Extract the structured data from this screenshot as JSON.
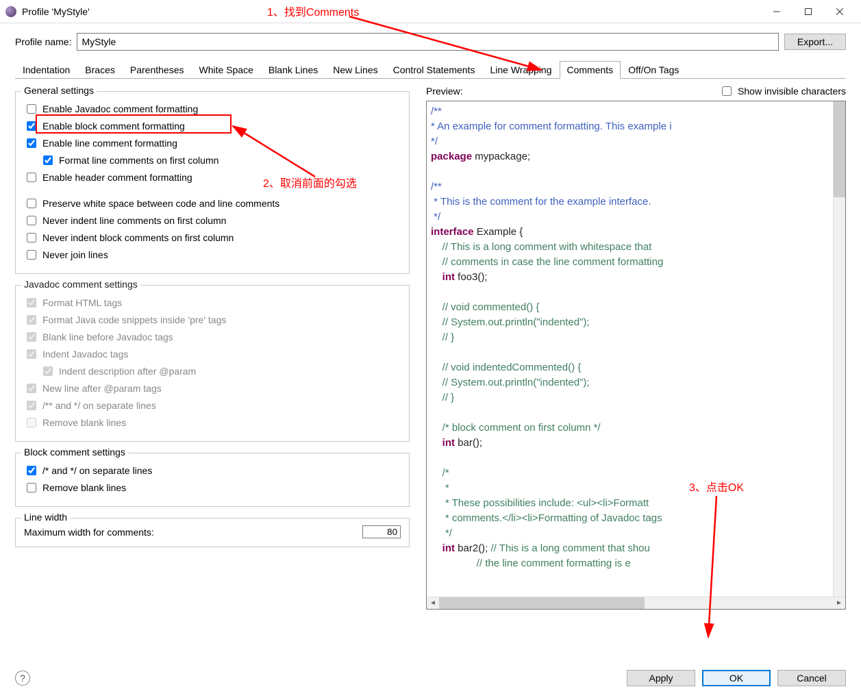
{
  "window": {
    "title": "Profile 'MyStyle'"
  },
  "profile": {
    "label": "Profile name:",
    "value": "MyStyle",
    "export_label": "Export..."
  },
  "tabs": {
    "items": [
      {
        "label": "Indentation"
      },
      {
        "label": "Braces"
      },
      {
        "label": "Parentheses"
      },
      {
        "label": "White Space"
      },
      {
        "label": "Blank Lines"
      },
      {
        "label": "New Lines"
      },
      {
        "label": "Control Statements"
      },
      {
        "label": "Line Wrapping"
      },
      {
        "label": "Comments"
      },
      {
        "label": "Off/On Tags"
      }
    ],
    "active_index": 8
  },
  "general": {
    "legend": "General settings",
    "enable_javadoc": {
      "label": "Enable Javadoc comment formatting",
      "checked": false
    },
    "enable_block": {
      "label": "Enable block comment formatting",
      "checked": true
    },
    "enable_line": {
      "label": "Enable line comment formatting",
      "checked": true
    },
    "format_line_first": {
      "label": "Format line comments on first column",
      "checked": true
    },
    "enable_header": {
      "label": "Enable header comment formatting",
      "checked": false
    },
    "preserve_ws": {
      "label": "Preserve white space between code and line comments",
      "checked": false
    },
    "never_indent_line": {
      "label": "Never indent line comments on first column",
      "checked": false
    },
    "never_indent_block": {
      "label": "Never indent block comments on first column",
      "checked": false
    },
    "never_join": {
      "label": "Never join lines",
      "checked": false
    }
  },
  "javadoc": {
    "legend": "Javadoc comment settings",
    "format_html": {
      "label": "Format HTML tags",
      "checked": true
    },
    "format_code_pre": {
      "label": "Format Java code snippets inside 'pre' tags",
      "checked": true
    },
    "blank_before_tags": {
      "label": "Blank line before Javadoc tags",
      "checked": true
    },
    "indent_javadoc": {
      "label": "Indent Javadoc tags",
      "checked": true
    },
    "indent_desc_param": {
      "label": "Indent description after @param",
      "checked": true
    },
    "newline_after_param": {
      "label": "New line after @param tags",
      "checked": true
    },
    "stars_separate": {
      "label": "/** and */ on separate lines",
      "checked": true
    },
    "remove_blank": {
      "label": "Remove blank lines",
      "checked": false
    }
  },
  "block": {
    "legend": "Block comment settings",
    "stars_separate": {
      "label": "/* and */ on separate lines",
      "checked": true
    },
    "remove_blank": {
      "label": "Remove blank lines",
      "checked": false
    }
  },
  "linewidth": {
    "legend": "Line width",
    "max_label": "Maximum width for comments:",
    "max_value": "80"
  },
  "preview": {
    "label": "Preview:",
    "show_invisible": {
      "label": "Show invisible characters",
      "checked": false
    }
  },
  "annotations": {
    "a1": "1、找到Comments",
    "a2": "2、取消前面的勾选",
    "a3": "3、点击OK"
  },
  "footer": {
    "apply": "Apply",
    "ok": "OK",
    "cancel": "Cancel"
  }
}
